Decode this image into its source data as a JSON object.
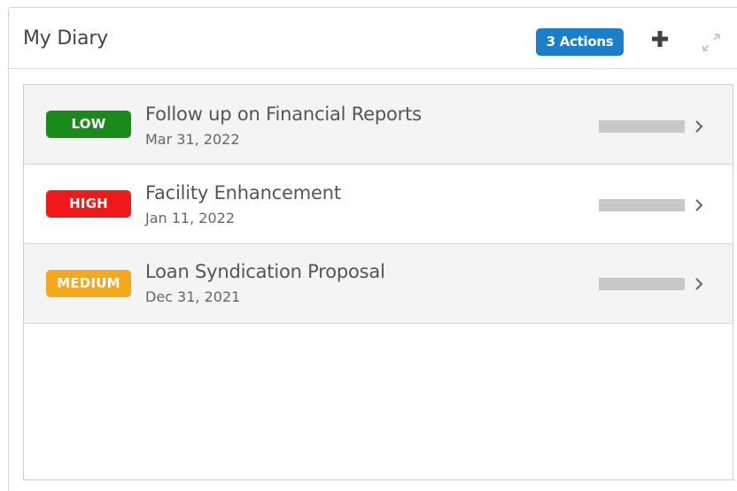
{
  "widget": {
    "title": "My Diary",
    "actions_badge": "3 Actions",
    "add_icon": "plus-icon",
    "expand_icon": "expand-icon"
  },
  "colors": {
    "accent": "#1a7fc8",
    "low": "#1a8a1a",
    "high": "#f01818",
    "medium": "#f6a81c"
  },
  "items": [
    {
      "priority": "LOW",
      "priority_color": "#1a8a1a",
      "title": "Follow up on Financial Reports",
      "date": "Mar 31, 2022"
    },
    {
      "priority": "HIGH",
      "priority_color": "#f01818",
      "title": "Facility Enhancement",
      "date": "Jan 11, 2022"
    },
    {
      "priority": "MEDIUM",
      "priority_color": "#f6a81c",
      "title": "Loan Syndication Proposal",
      "date": "Dec 31, 2021"
    }
  ]
}
